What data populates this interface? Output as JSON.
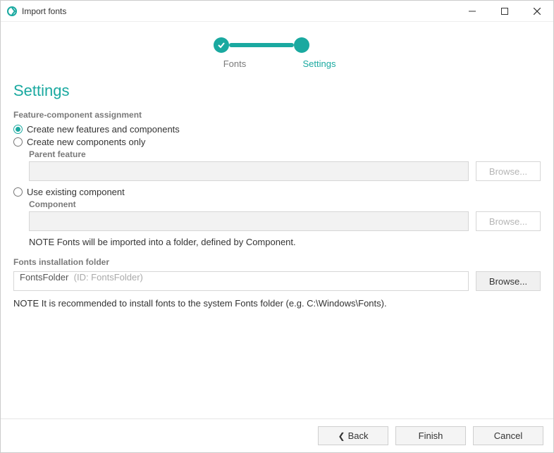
{
  "window": {
    "title": "Import fonts"
  },
  "stepper": {
    "steps": [
      {
        "label": "Fonts",
        "state": "done"
      },
      {
        "label": "Settings",
        "state": "current"
      }
    ]
  },
  "page": {
    "heading": "Settings"
  },
  "feature_assignment": {
    "group_label": "Feature-component assignment",
    "options": {
      "create_features": {
        "label": "Create new features and components",
        "selected": true
      },
      "create_components": {
        "label": "Create new components only",
        "selected": false
      },
      "use_existing": {
        "label": "Use existing component",
        "selected": false
      }
    },
    "parent_feature": {
      "label": "Parent feature",
      "value": "",
      "browse": "Browse..."
    },
    "component": {
      "label": "Component",
      "value": "",
      "browse": "Browse..."
    },
    "note": "NOTE Fonts will be imported into a folder, defined by Component."
  },
  "install_folder": {
    "group_label": "Fonts installation folder",
    "value": "FontsFolder",
    "hint": "(ID: FontsFolder)",
    "browse": "Browse...",
    "note": "NOTE It is recommended to install fonts to the system Fonts folder (e.g. C:\\Windows\\Fonts)."
  },
  "footer": {
    "back": "Back",
    "finish": "Finish",
    "cancel": "Cancel"
  },
  "colors": {
    "accent": "#1aa9a0"
  }
}
